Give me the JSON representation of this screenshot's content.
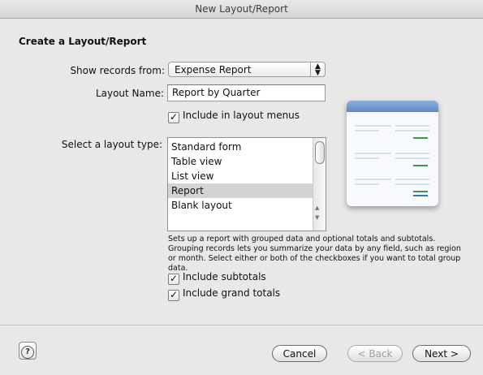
{
  "window": {
    "title": "New Layout/Report"
  },
  "form": {
    "heading": "Create a Layout/Report",
    "show_records_label": "Show records from:",
    "show_records_value": "Expense Report",
    "layout_name_label": "Layout Name:",
    "layout_name_value": "Report by Quarter",
    "include_in_menus_label": "Include in layout menus",
    "include_in_menus_checked": true,
    "layout_type_label": "Select a layout type:",
    "layout_types": [
      {
        "label": "Standard form",
        "selected": false
      },
      {
        "label": "Table view",
        "selected": false
      },
      {
        "label": "List view",
        "selected": false
      },
      {
        "label": "Report",
        "selected": true
      },
      {
        "label": "Blank layout",
        "selected": false
      }
    ],
    "description": "Sets up a report with grouped data and optional totals and subtotals. Grouping records lets you summarize your data by any field, such as region or month. Select either or both of the checkboxes if you want to total group data.",
    "include_subtotals_label": "Include subtotals",
    "include_subtotals_checked": true,
    "include_grand_totals_label": "Include grand totals",
    "include_grand_totals_checked": true
  },
  "icons": {
    "checkmark": "✓",
    "select_arrows": "⬍",
    "help": "?"
  },
  "buttons": {
    "help_label": "?",
    "cancel_label": "Cancel",
    "back_label": "< Back",
    "next_label": "Next >"
  },
  "colors": {
    "preview_header": "#5f86c2",
    "preview_accent_green": "#3c9a4e",
    "preview_accent_blue": "#4a6ea8",
    "selected_row": "#d4d4d4"
  }
}
